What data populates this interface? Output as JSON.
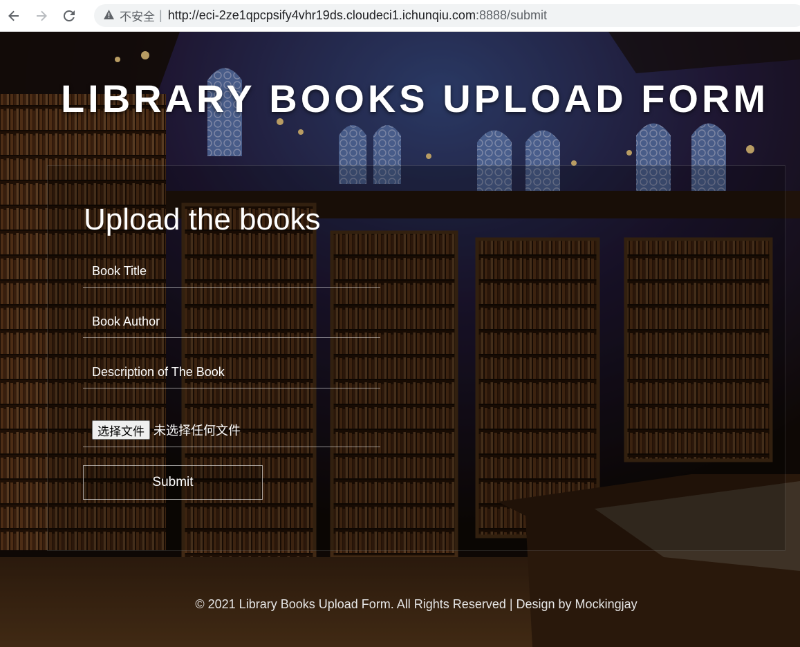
{
  "browser": {
    "security_label": "不安全",
    "url_host": "http://eci-2ze1qpcpsify4vhr19ds.cloudeci1.ichunqiu.com",
    "url_rest": ":8888/submit"
  },
  "page": {
    "title": "LIBRARY BOOKS UPLOAD FORM",
    "form_heading": "Upload the books",
    "fields": {
      "title_placeholder": "Book Title",
      "author_placeholder": "Book Author",
      "description_placeholder": "Description of The Book"
    },
    "file_input": {
      "button_label": "选择文件",
      "status": "未选择任何文件"
    },
    "submit_label": "Submit",
    "footer": "© 2021 Library Books Upload Form. All Rights Reserved | Design by Mockingjay"
  }
}
